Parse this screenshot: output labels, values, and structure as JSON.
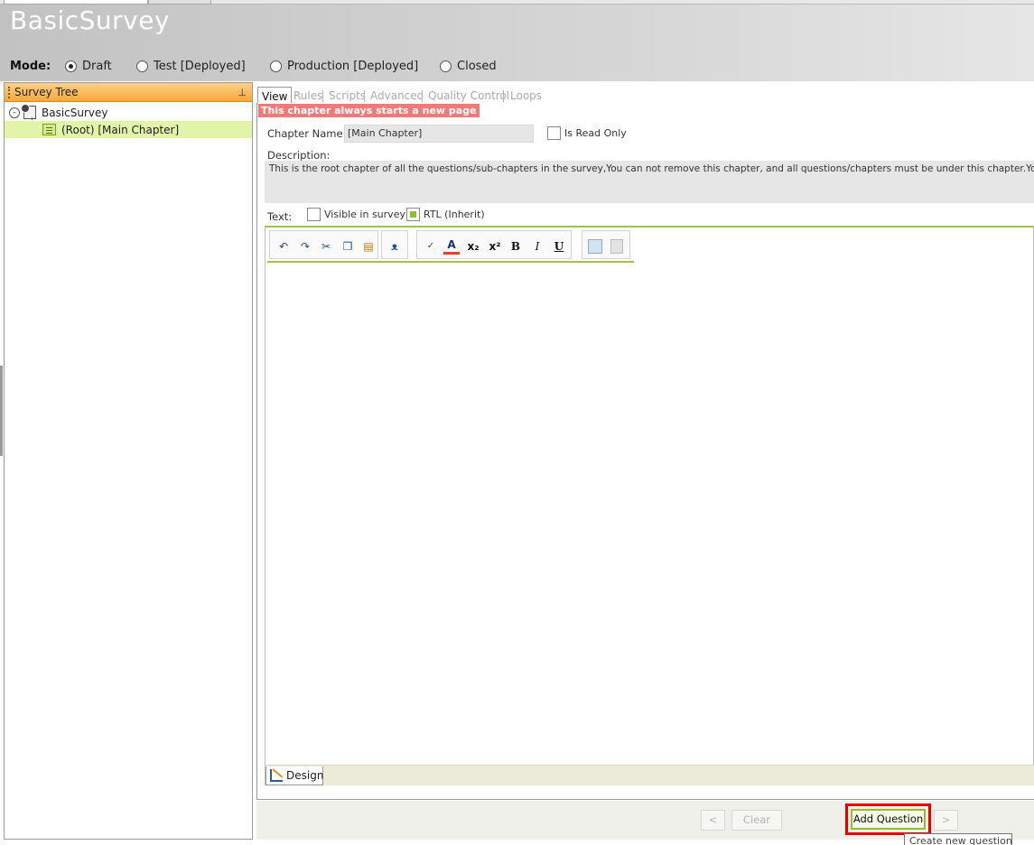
{
  "app": {
    "title": "BasicSurvey"
  },
  "mode": {
    "label": "Mode:",
    "options": [
      {
        "label": "Draft",
        "selected": true
      },
      {
        "label": "Test [Deployed]",
        "selected": false
      },
      {
        "label": "Production [Deployed]",
        "selected": false
      },
      {
        "label": "Closed",
        "selected": false
      }
    ]
  },
  "sidebar": {
    "title": "Survey Tree",
    "tree": [
      {
        "label": "BasicSurvey",
        "type": "survey",
        "selected": false
      },
      {
        "label": "(Root) [Main Chapter]",
        "type": "chapter",
        "selected": true
      }
    ]
  },
  "tabs": [
    {
      "label": "View",
      "active": true
    },
    {
      "label": "Rules",
      "active": false
    },
    {
      "label": "Scripts",
      "active": false
    },
    {
      "label": "Advanced",
      "active": false
    },
    {
      "label": "Quality Control",
      "active": false
    },
    {
      "label": "Loops",
      "active": false
    }
  ],
  "chapter": {
    "new_page_badge": "This chapter always starts a new page",
    "name_label": "Chapter Name:",
    "name_value": "[Main Chapter]",
    "read_only_label": "Is Read Only",
    "description_label": "Description:",
    "description_value": "This is the root chapter of all the questions/sub-chapters in the survey,You can not remove this chapter, and all questions/chapters must be under this chapter.You ca",
    "text_label": "Text:",
    "visible_label": "Visible in survey",
    "rtl_label": "RTL (Inherit)"
  },
  "editor": {
    "toolbar": [
      "undo-icon",
      "redo-icon",
      "cut-icon",
      "copy-icon",
      "paste-icon",
      "find-icon",
      "spellcheck-icon",
      "font-color-icon",
      "subscript-icon",
      "superscript-icon",
      "bold-icon",
      "italic-icon",
      "underline-icon",
      "insert-image-icon",
      "insert-object-icon"
    ],
    "design_tab": "Design"
  },
  "navigation": {
    "prev_label": "<",
    "clear_label": "Clear",
    "add_question_label": "Add Question",
    "next_label": ">",
    "tooltip": "Create new question"
  },
  "colors": {
    "sidebar_header": "#f6a83a",
    "selection": "#e3f3a8",
    "highlight": "#e80000",
    "accent_green": "#8fbf30",
    "badge": "#f07a7a"
  }
}
